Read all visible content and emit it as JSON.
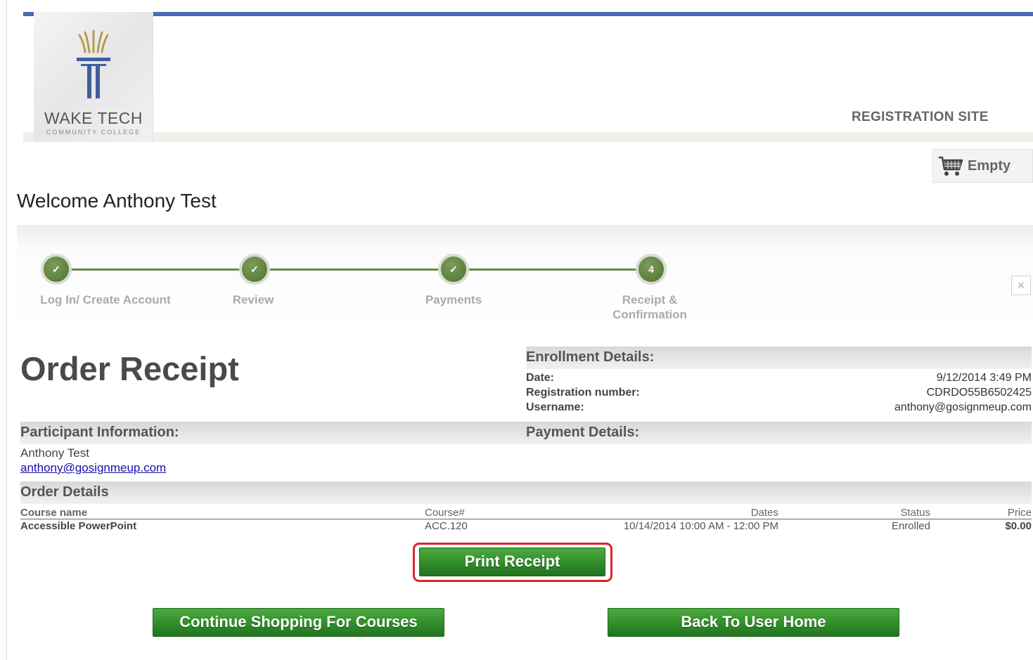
{
  "header": {
    "logo_name": "WAKE TECH",
    "logo_subtitle": "COMMUNITY COLLEGE",
    "site_label": "REGISTRATION SITE",
    "cart_label": "Empty",
    "accent_color": "#4a6db3"
  },
  "welcome": "Welcome Anthony Test",
  "progress": {
    "steps": [
      {
        "marker": "✓",
        "label": "Log In/ Create Account",
        "state": "complete"
      },
      {
        "marker": "✓",
        "label": "Review",
        "state": "complete"
      },
      {
        "marker": "✓",
        "label": "Payments",
        "state": "complete"
      },
      {
        "marker": "4",
        "label_line1": "Receipt &",
        "label_line2": "Confirmation",
        "state": "current"
      }
    ],
    "close_icon": "×"
  },
  "order_title": "Order Receipt",
  "enrollment": {
    "heading": "Enrollment Details:",
    "date_label": "Date:",
    "date_value": "9/12/2014 3:49 PM",
    "reg_label": "Registration number:",
    "reg_value": "CDRDO55B6502425",
    "user_label": "Username:",
    "user_value": "anthony@gosignmeup.com"
  },
  "participant": {
    "heading": "Participant Information:",
    "name": "Anthony Test",
    "email": "anthony@gosignmeup.com"
  },
  "payment": {
    "heading": "Payment Details:"
  },
  "order_details": {
    "heading": "Order Details",
    "columns": {
      "course_name": "Course name",
      "course_num": "Course#",
      "dates": "Dates",
      "status": "Status",
      "price": "Price"
    },
    "rows": [
      {
        "course_name": "Accessible PowerPoint",
        "course_num": "ACC.120",
        "dates": "10/14/2014 10:00 AM - 12:00 PM",
        "status": "Enrolled",
        "price": "$0.00"
      }
    ]
  },
  "buttons": {
    "print": "Print Receipt",
    "continue": "Continue Shopping For Courses",
    "home": "Back To User Home"
  },
  "colors": {
    "button_green": "#2f8a2a",
    "step_green": "#5a7d3a",
    "highlight_red": "#d9262b"
  }
}
